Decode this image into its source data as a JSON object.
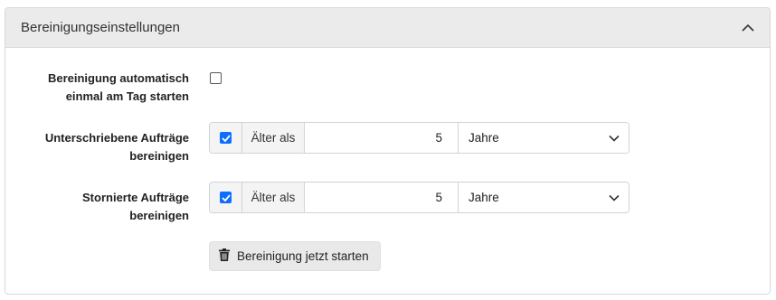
{
  "panel": {
    "title": "Bereinigungseinstellungen",
    "collapse_icon": "chevron-up-icon"
  },
  "auto_cleanup": {
    "label_line1": "Bereinigung automatisch",
    "label_line2": "einmal am Tag starten",
    "checked": false
  },
  "signed_orders": {
    "label_line1": "Unterschriebene Aufträge",
    "label_line2": "bereinigen",
    "checked": true,
    "prefix": "Älter als",
    "value": "5",
    "unit": "Jahre"
  },
  "cancelled_orders": {
    "label_line1": "Stornierte Aufträge",
    "label_line2": "bereinigen",
    "checked": true,
    "prefix": "Älter als",
    "value": "5",
    "unit": "Jahre"
  },
  "start_button": {
    "label": "Bereinigung jetzt starten",
    "icon": "trash-icon"
  },
  "colors": {
    "checkbox_accent": "#0d6efd",
    "header_bg": "#ebebeb",
    "button_bg": "#e9e9e9"
  }
}
